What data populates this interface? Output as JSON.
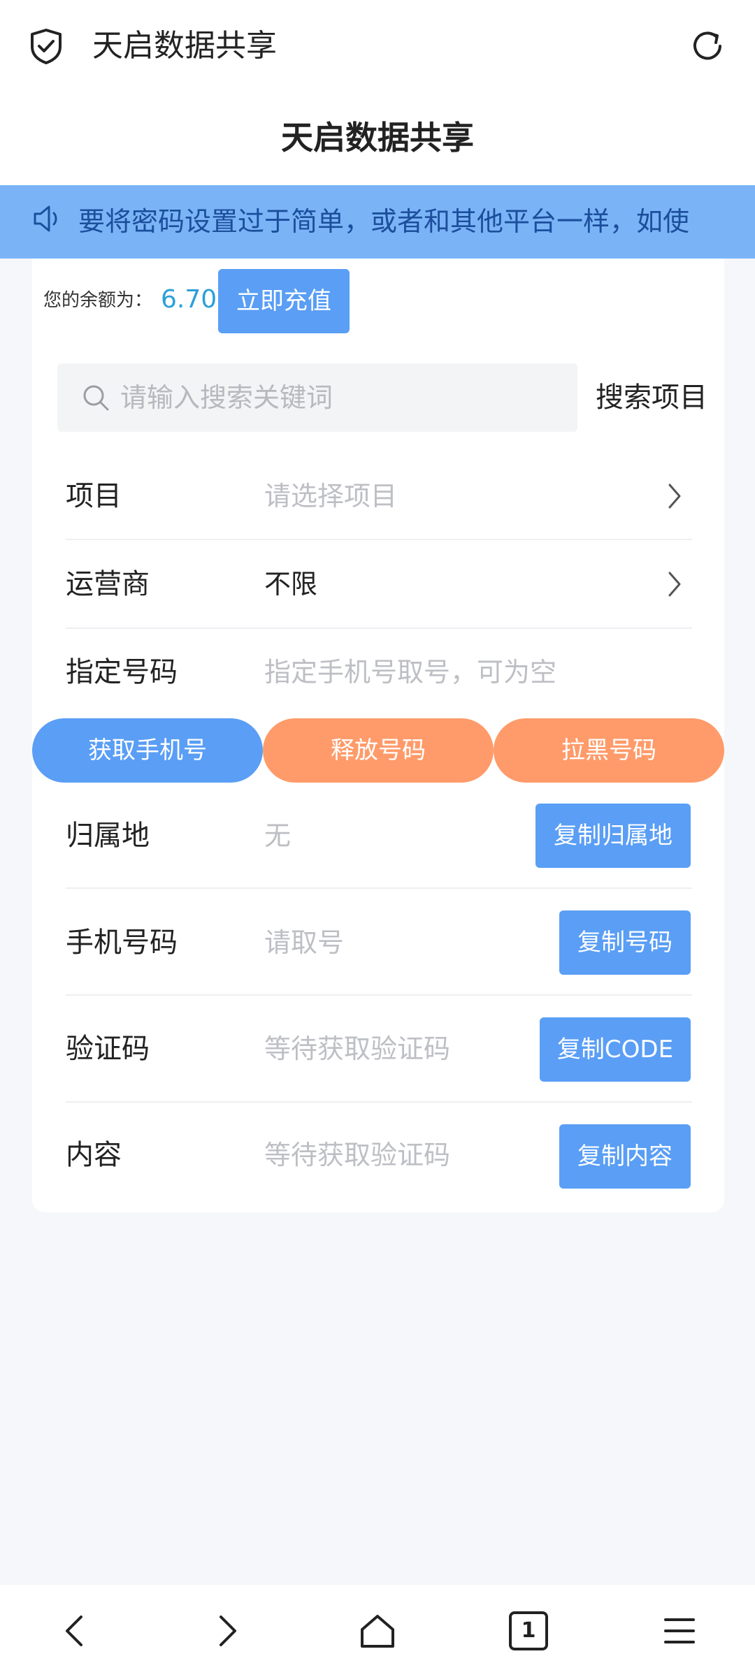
{
  "browser": {
    "title": "天启数据共享"
  },
  "header": {
    "title": "天启数据共享"
  },
  "notice": {
    "text": "要将密码设置过于简单，或者和其他平台一样，如使"
  },
  "balance": {
    "label": "您的余额为：",
    "value": "6.70",
    "recharge_label": "立即充值"
  },
  "search": {
    "placeholder": "请输入搜索关键词",
    "button_label": "搜索项目"
  },
  "form": {
    "project": {
      "label": "项目",
      "placeholder": "请选择项目"
    },
    "carrier": {
      "label": "运营商",
      "value": "不限"
    },
    "number": {
      "label": "指定号码",
      "placeholder": "指定手机号取号，可为空"
    }
  },
  "actions": {
    "get_phone": "获取手机号",
    "release": "释放号码",
    "blacklist": "拉黑号码"
  },
  "results": {
    "location": {
      "label": "归属地",
      "value": "无",
      "copy_label": "复制归属地"
    },
    "phone": {
      "label": "手机号码",
      "value": "请取号",
      "copy_label": "复制号码"
    },
    "code": {
      "label": "验证码",
      "value": "等待获取验证码",
      "copy_label": "复制CODE"
    },
    "content": {
      "label": "内容",
      "value": "等待获取验证码",
      "copy_label": "复制内容"
    }
  },
  "colors": {
    "accent": "#5a9ef5",
    "notice_bg": "#7ab4f6",
    "orange": "#ff9b6a",
    "balance": "#2aa0d8"
  },
  "icons": {
    "browser_left": "shield-check-icon",
    "browser_right": "refresh-icon",
    "notice": "speaker-icon",
    "search": "search-icon",
    "row_arrow": "chevron-right-icon",
    "nav": [
      "back-icon",
      "forward-icon",
      "home-icon",
      "tabs-icon",
      "menu-icon"
    ]
  },
  "nav": {
    "tabs_count": "1"
  }
}
